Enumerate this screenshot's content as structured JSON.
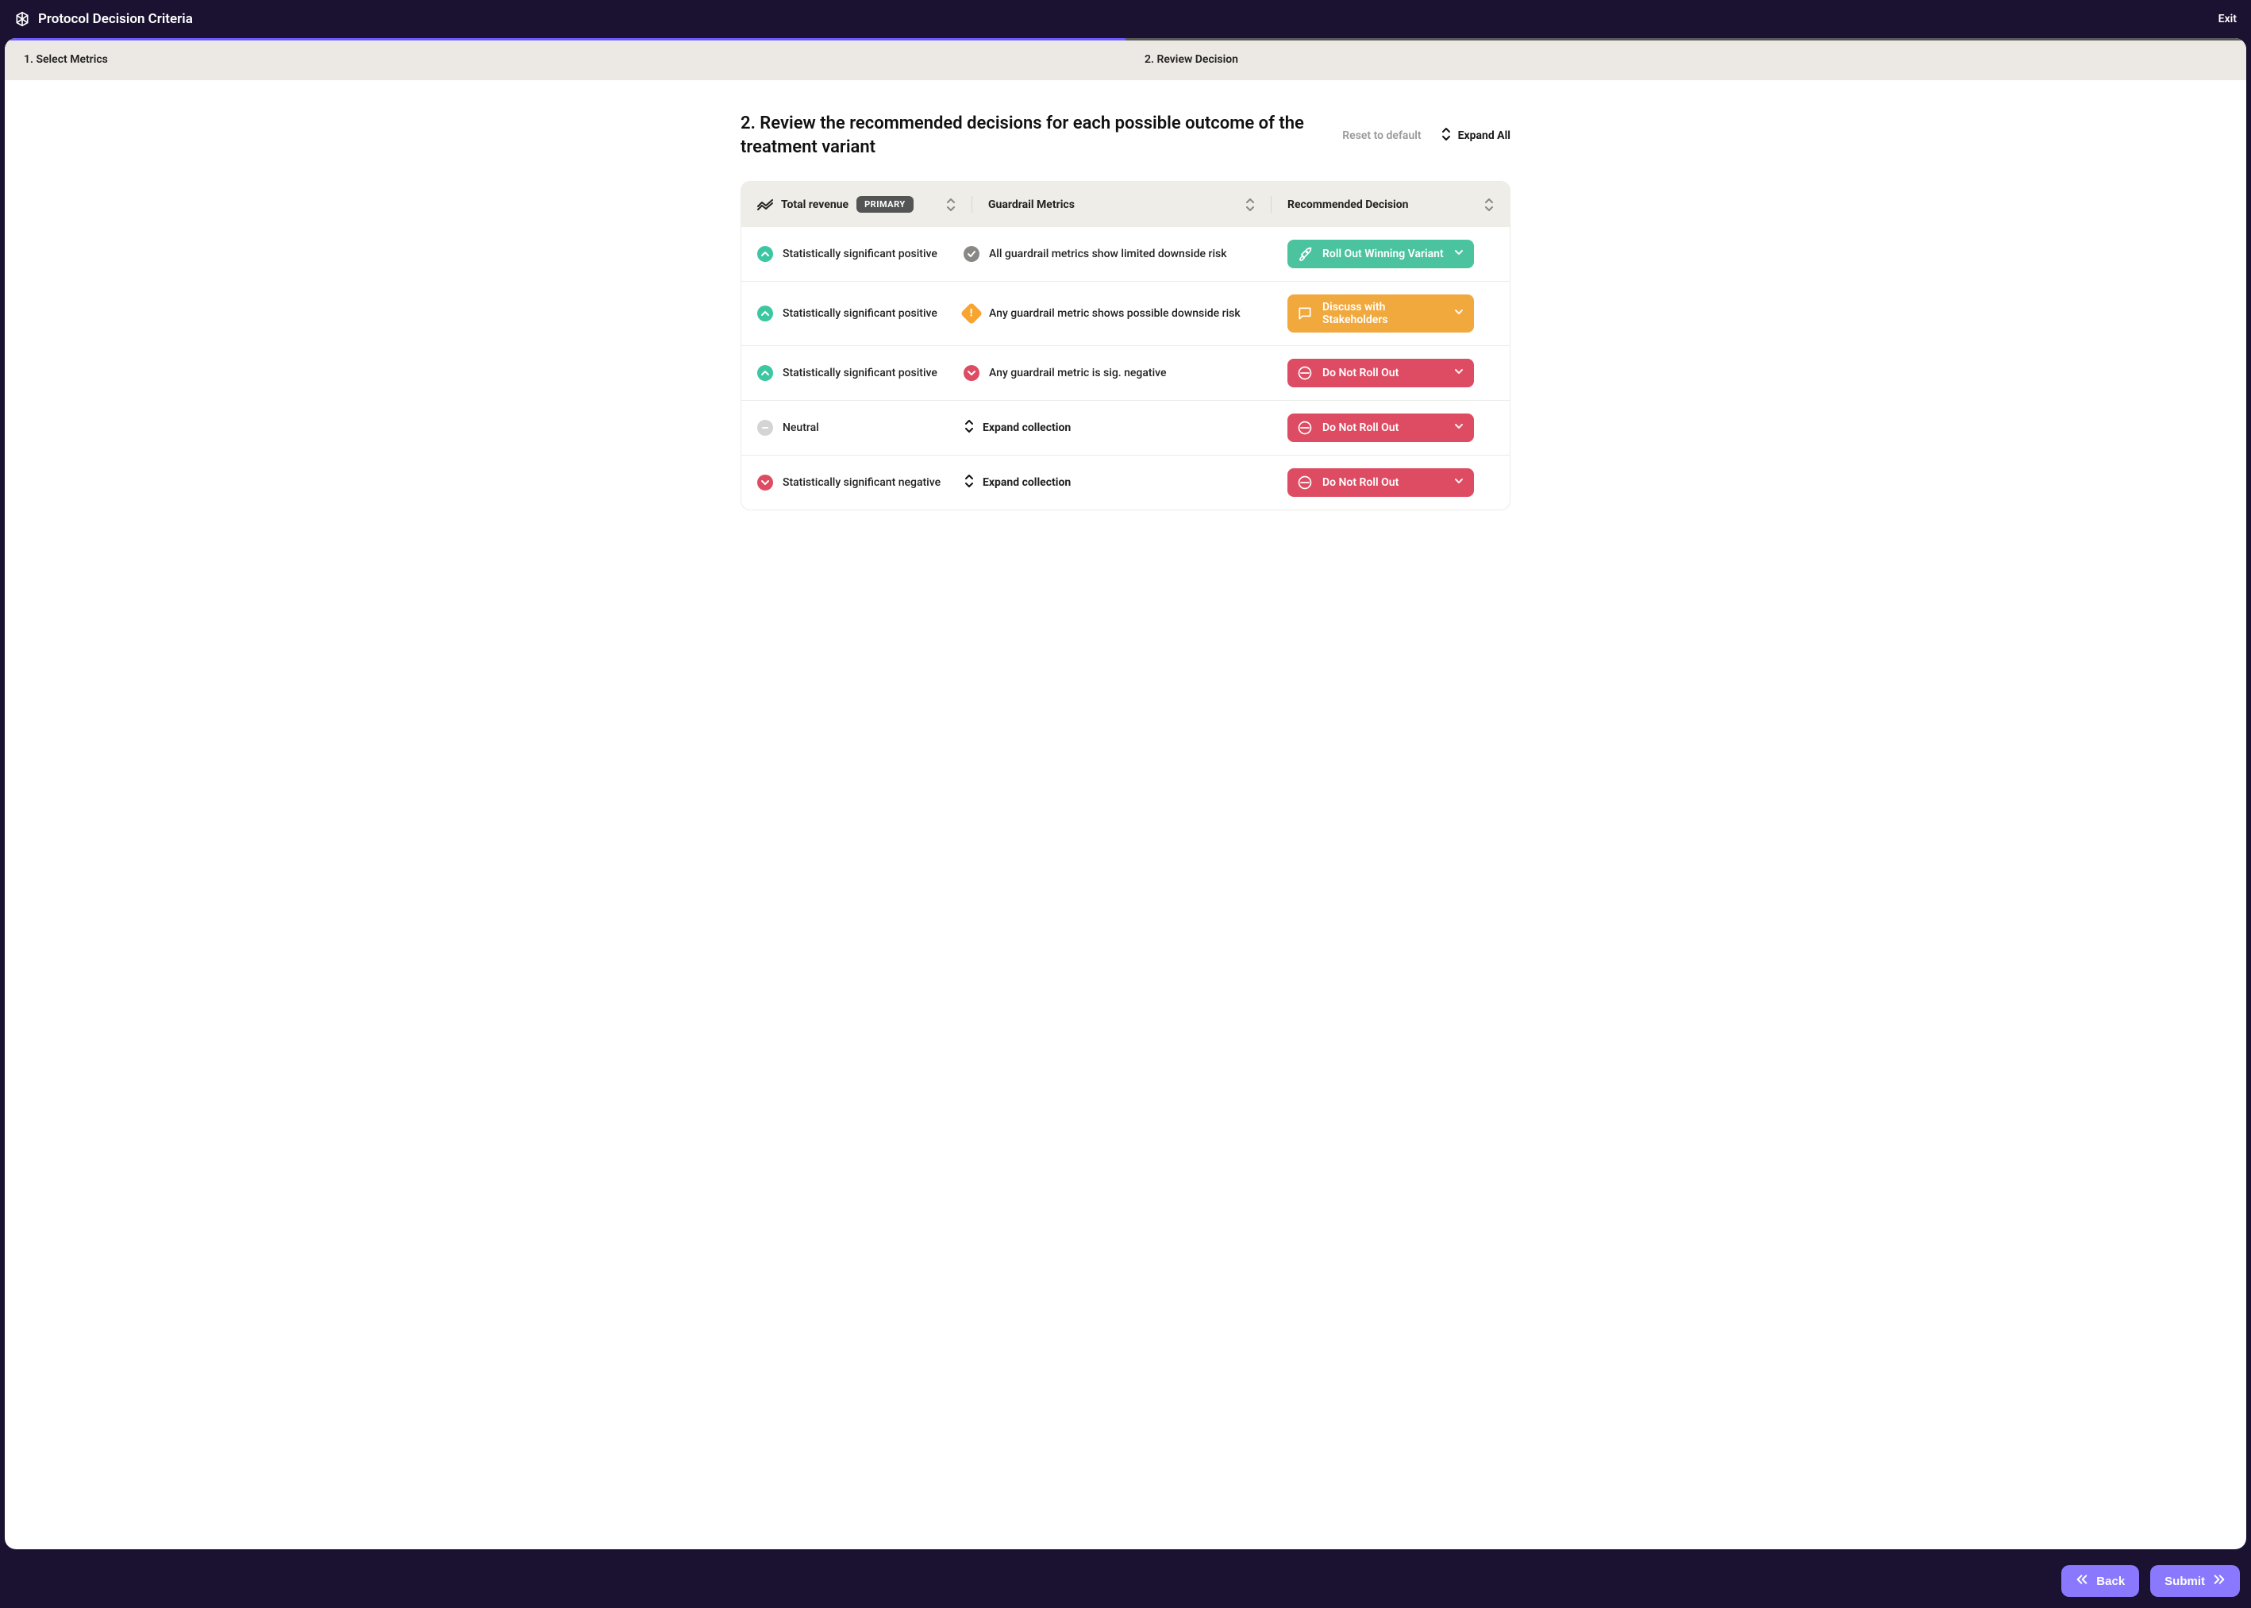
{
  "header": {
    "title": "Protocol Decision Criteria",
    "exit_label": "Exit"
  },
  "steps": {
    "step1": "1. Select Metrics",
    "step2": "2. Review Decision"
  },
  "page": {
    "heading": "2. Review the recommended decisions for each possible outcome of the treatment variant",
    "reset_label": "Reset to default",
    "expand_all_label": "Expand All"
  },
  "table": {
    "primary_metric": "Total revenue",
    "primary_badge": "PRIMARY",
    "guardrail_header": "Guardrail Metrics",
    "decision_header": "Recommended Decision",
    "rows": [
      {
        "primary_status": "positive",
        "primary_text": "Statistically significant positive",
        "guardrail_kind": "ok",
        "guardrail_text": "All guardrail metrics show limited downside risk",
        "decision_type": "rollout",
        "decision_label": "Roll Out Winning Variant"
      },
      {
        "primary_status": "positive",
        "primary_text": "Statistically significant positive",
        "guardrail_kind": "warn",
        "guardrail_text": "Any guardrail metric shows possible downside risk",
        "decision_type": "discuss",
        "decision_label": "Discuss with Stakeholders"
      },
      {
        "primary_status": "positive",
        "primary_text": "Statistically significant positive",
        "guardrail_kind": "negative",
        "guardrail_text": "Any guardrail metric is sig. negative",
        "decision_type": "donot",
        "decision_label": "Do Not Roll Out"
      },
      {
        "primary_status": "neutral",
        "primary_text": "Neutral",
        "guardrail_kind": "expand",
        "guardrail_text": "Expand collection",
        "decision_type": "donot",
        "decision_label": "Do Not Roll Out"
      },
      {
        "primary_status": "negative",
        "primary_text": "Statistically significant negative",
        "guardrail_kind": "expand",
        "guardrail_text": "Expand collection",
        "decision_type": "donot",
        "decision_label": "Do Not Roll Out"
      }
    ]
  },
  "footer": {
    "back_label": "Back",
    "submit_label": "Submit"
  },
  "colors": {
    "accent": "#8a79ff",
    "green": "#4cc39f",
    "orange": "#f1a93e",
    "red": "#dd4c62",
    "bg_dark": "#1b1231"
  }
}
